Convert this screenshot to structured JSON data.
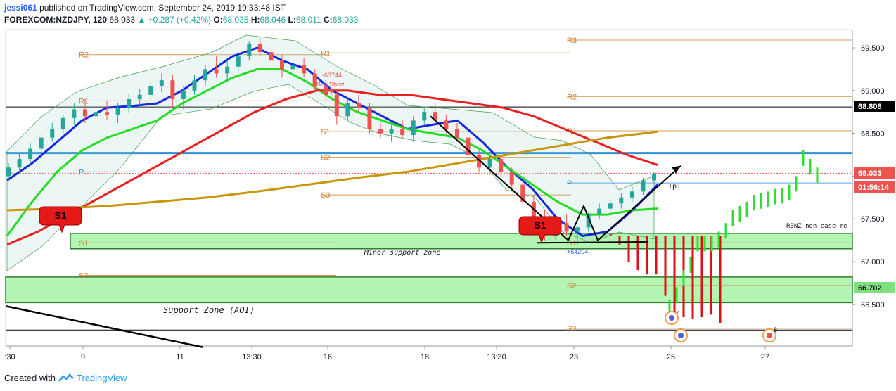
{
  "header": {
    "user": "jessi061",
    "published": "published on TradingView.com, September 24, 2019 19:33:48 IST",
    "symbol": "FOREXCOM:NZDJPY, 120",
    "last": "68.033",
    "change": "+0.287 (+0.42%)",
    "o_label": "O:",
    "o_val": "68.035",
    "h_label": "H:",
    "h_val": "68.046",
    "l_label": "L:",
    "l_val": "68.011",
    "c_label": "C:",
    "c_val": "68.033"
  },
  "footer": {
    "created": "Created with",
    "brand": "TradingView"
  },
  "chart_data": {
    "type": "candlestick",
    "symbol": "FOREXCOM:NZDJPY",
    "interval": "120",
    "ylim": [
      66.0,
      69.8
    ],
    "y_ticks": [
      69.5,
      69.0,
      68.5,
      68.0,
      67.5,
      67.0,
      66.5
    ],
    "y_tick_labels": [
      "69.500",
      "69.000",
      "68.500",
      "68.000",
      "67.500",
      "67.000",
      "66.500"
    ],
    "x_tick_labels": [
      ":30",
      "9",
      "11",
      "13:30",
      "16",
      "18",
      "13:30",
      "23",
      "25",
      "27"
    ],
    "price_labels": [
      {
        "text": "68.808",
        "value": 68.808,
        "bg": "#000000",
        "fg": "#ffffff"
      },
      {
        "text": "68.033",
        "value": 68.033,
        "bg": "#ef5350",
        "fg": "#ffffff"
      },
      {
        "text": "01:56:14",
        "value": 67.92,
        "bg": "#ef5350",
        "fg": "#ffffff"
      },
      {
        "text": "66.702",
        "value": 66.702,
        "bg": "#7ee07e",
        "fg": "#131722"
      }
    ],
    "colors": {
      "up": "#26a69a",
      "down": "#ef5350",
      "ma_fast": "#1428e0",
      "ma_mid": "#22dd22",
      "ma_slow": "#e82020",
      "ma_long": "#c8960a",
      "pivot": "#d08030",
      "zone": "#b4f5b4",
      "zone_border": "#2e7d32",
      "blue_line": "#2a8fd8",
      "projection_up": "#33dd33",
      "projection_down": "#dd1111"
    },
    "candles": [
      [
        68.0,
        68.15,
        67.93,
        68.1
      ],
      [
        68.1,
        68.26,
        68.05,
        68.2
      ],
      [
        68.2,
        68.38,
        68.15,
        68.32
      ],
      [
        68.32,
        68.5,
        68.28,
        68.45
      ],
      [
        68.45,
        68.62,
        68.4,
        68.55
      ],
      [
        68.55,
        68.72,
        68.5,
        68.68
      ],
      [
        68.68,
        68.85,
        68.6,
        68.78
      ],
      [
        68.78,
        68.9,
        68.62,
        68.7
      ],
      [
        68.7,
        68.82,
        68.6,
        68.75
      ],
      [
        68.75,
        68.88,
        68.65,
        68.72
      ],
      [
        68.72,
        68.86,
        68.62,
        68.8
      ],
      [
        68.8,
        68.96,
        68.74,
        68.9
      ],
      [
        68.9,
        69.02,
        68.82,
        68.95
      ],
      [
        68.95,
        69.1,
        68.9,
        69.05
      ],
      [
        69.05,
        69.2,
        68.98,
        69.12
      ],
      [
        69.12,
        69.18,
        68.8,
        68.9
      ],
      [
        68.9,
        69.05,
        68.78,
        69.0
      ],
      [
        69.0,
        69.18,
        68.95,
        69.12
      ],
      [
        69.12,
        69.3,
        69.05,
        69.25
      ],
      [
        69.25,
        69.4,
        69.15,
        69.2
      ],
      [
        69.2,
        69.35,
        69.1,
        69.28
      ],
      [
        69.28,
        69.45,
        69.2,
        69.4
      ],
      [
        69.4,
        69.58,
        69.35,
        69.55
      ],
      [
        69.55,
        69.62,
        69.4,
        69.45
      ],
      [
        69.45,
        69.55,
        69.3,
        69.35
      ],
      [
        69.35,
        69.42,
        69.15,
        69.25
      ],
      [
        69.25,
        69.35,
        69.1,
        69.3
      ],
      [
        69.3,
        69.38,
        69.15,
        69.2
      ],
      [
        69.2,
        69.25,
        69.0,
        69.05
      ],
      [
        69.05,
        69.12,
        68.88,
        68.95
      ],
      [
        68.95,
        69.02,
        68.6,
        68.7
      ],
      [
        68.7,
        68.9,
        68.65,
        68.85
      ],
      [
        68.85,
        68.95,
        68.75,
        68.8
      ],
      [
        68.8,
        68.85,
        68.5,
        68.55
      ],
      [
        68.55,
        68.62,
        68.45,
        68.5
      ],
      [
        68.5,
        68.6,
        68.4,
        68.55
      ],
      [
        68.55,
        68.65,
        68.45,
        68.48
      ],
      [
        68.48,
        68.7,
        68.4,
        68.65
      ],
      [
        68.65,
        68.8,
        68.6,
        68.75
      ],
      [
        68.75,
        68.85,
        68.6,
        68.65
      ],
      [
        68.65,
        68.72,
        68.5,
        68.55
      ],
      [
        68.55,
        68.62,
        68.4,
        68.45
      ],
      [
        68.45,
        68.52,
        68.2,
        68.25
      ],
      [
        68.25,
        68.3,
        68.05,
        68.1
      ],
      [
        68.1,
        68.25,
        68.05,
        68.2
      ],
      [
        68.2,
        68.25,
        68.0,
        68.05
      ],
      [
        68.05,
        68.1,
        67.85,
        67.9
      ],
      [
        67.9,
        67.95,
        67.65,
        67.7
      ],
      [
        67.7,
        67.78,
        67.45,
        67.5
      ],
      [
        67.5,
        67.6,
        67.25,
        67.3
      ],
      [
        67.3,
        67.5,
        67.25,
        67.45
      ],
      [
        67.45,
        67.55,
        67.3,
        67.35
      ],
      [
        67.35,
        67.42,
        67.2,
        67.4
      ],
      [
        67.4,
        67.58,
        67.35,
        67.55
      ],
      [
        67.55,
        67.68,
        67.5,
        67.62
      ],
      [
        67.62,
        67.72,
        67.55,
        67.68
      ],
      [
        67.68,
        67.8,
        67.62,
        67.75
      ],
      [
        67.75,
        67.88,
        67.7,
        67.82
      ],
      [
        67.82,
        67.98,
        67.78,
        67.95
      ],
      [
        67.95,
        68.05,
        67.9,
        68.03
      ]
    ],
    "moving_averages": [
      {
        "name": "fast",
        "color": "#1428e0",
        "values": [
          67.95,
          68.15,
          68.4,
          68.65,
          68.8,
          68.82,
          68.85,
          69.0,
          69.2,
          69.4,
          69.5,
          69.35,
          69.25,
          69.0,
          68.85,
          68.7,
          68.55,
          68.6,
          68.65,
          68.4,
          68.1,
          67.85,
          67.5,
          67.3,
          67.35,
          67.6,
          67.9
        ]
      },
      {
        "name": "mid",
        "color": "#22dd22",
        "values": [
          67.3,
          67.7,
          68.05,
          68.3,
          68.45,
          68.55,
          68.65,
          68.85,
          69.0,
          69.15,
          69.25,
          69.25,
          69.1,
          68.9,
          68.75,
          68.65,
          68.55,
          68.5,
          68.45,
          68.3,
          68.1,
          67.9,
          67.7,
          67.55,
          67.55,
          67.6,
          67.62
        ]
      },
      {
        "name": "slow",
        "color": "#e82020",
        "values": [
          67.2,
          67.35,
          67.55,
          67.75,
          67.95,
          68.15,
          68.35,
          68.55,
          68.75,
          68.9,
          69.0,
          69.0,
          68.95,
          68.95,
          68.9,
          68.85,
          68.8,
          68.7,
          68.55,
          68.4,
          68.25,
          68.13
        ]
      },
      {
        "name": "long",
        "color": "#c8960a",
        "values": [
          67.6,
          67.62,
          67.65,
          67.7,
          67.75,
          67.82,
          67.9,
          67.98,
          68.05,
          68.15,
          68.25,
          68.35,
          68.45,
          68.52
        ]
      }
    ],
    "pivot_levels": [
      {
        "label": "R2",
        "value": 69.42
      },
      {
        "label": "R1",
        "value": 68.88
      },
      {
        "label": "P",
        "value": 68.05
      },
      {
        "label": "R1",
        "value": 69.44
      },
      {
        "label": "S1",
        "value": 68.52
      },
      {
        "label": "S2",
        "value": 68.22
      },
      {
        "label": "S3",
        "value": 67.78
      },
      {
        "label": "R3",
        "value": 69.59
      },
      {
        "label": "R2",
        "value": 68.93
      },
      {
        "label": "R1",
        "value": 68.53
      },
      {
        "label": "P",
        "value": 67.92
      },
      {
        "label": "S1",
        "value": 67.22
      },
      {
        "label": "S2",
        "value": 66.84
      },
      {
        "label": "S3",
        "value": 66.22
      },
      {
        "label": "S1",
        "value": 67.22
      },
      {
        "label": "S2",
        "value": 66.72
      }
    ],
    "zones": [
      {
        "name": "Minor support zone",
        "from": 67.15,
        "to": 67.33
      },
      {
        "name": "Support Zone (AOI)",
        "from": 66.52,
        "to": 66.82
      }
    ],
    "horizontal_lines": [
      {
        "value": 68.808,
        "color": "#000000"
      },
      {
        "value": 68.27,
        "color": "#2a8fd8"
      },
      {
        "value": 66.2,
        "color": "#000000"
      }
    ],
    "annotations": {
      "buy_short_value": "-63744",
      "buy_short_label": "Buy Short",
      "sell_value": "+54204",
      "minor_zone": "Minor support zone",
      "support_zone": "Support Zone (AOI)",
      "tp1": "Tp1",
      "rbnz": "RBNZ non ease re",
      "s1_badge": "S1",
      "event_count_1": "4",
      "event_count_2": "8"
    },
    "projection": {
      "down": [
        67.32,
        67.2,
        67.0,
        66.9,
        66.85,
        66.85,
        66.6,
        66.4,
        66.35,
        66.33,
        66.35,
        66.38,
        66.28
      ],
      "up": [
        66.55,
        66.7,
        66.9,
        67.05,
        67.3,
        67.3,
        67.3,
        67.35,
        67.45,
        67.6,
        67.65,
        67.7,
        67.78,
        67.8,
        67.82,
        67.85,
        67.86,
        67.9,
        68.0,
        68.3,
        68.2,
        68.1
      ]
    }
  }
}
